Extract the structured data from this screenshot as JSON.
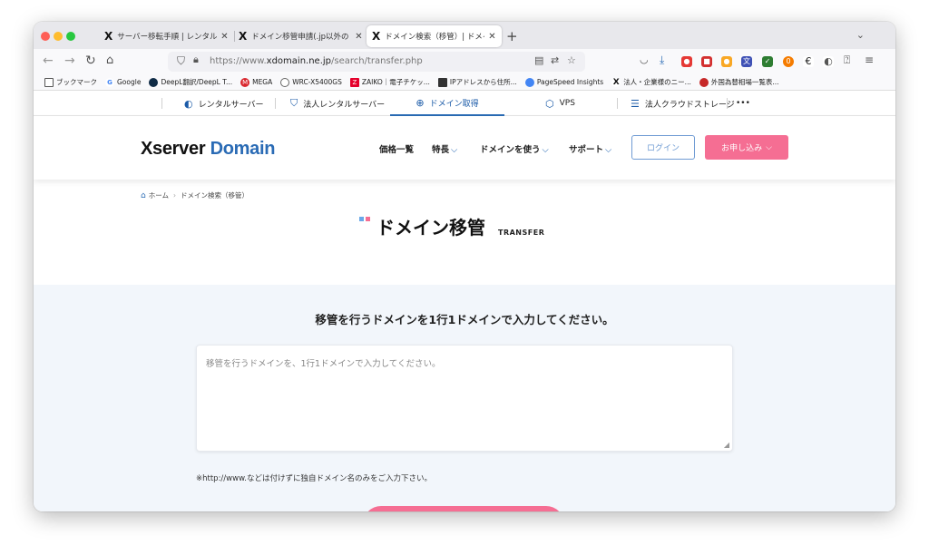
{
  "browser": {
    "tabs": [
      {
        "label": "サーバー移転手順 | レンタルサー",
        "active": false
      },
      {
        "label": "ドメイン移管申請(.jp以外のドメ",
        "active": false
      },
      {
        "label": "ドメイン検索（移管）| ドメイン",
        "active": true
      }
    ],
    "url_prefix": "https://www.",
    "url_host": "xdomain.ne.jp",
    "url_path": "/search/transfer.php"
  },
  "bookmarks": [
    {
      "label": "ブックマーク",
      "icon": "folder-icon",
      "color": "#555555"
    },
    {
      "label": "Google",
      "icon": "google-icon",
      "color": "#4285f4"
    },
    {
      "label": "DeepL翻訳/DeepL T...",
      "icon": "deepl-icon",
      "color": "#0f2b46"
    },
    {
      "label": "MEGA",
      "icon": "mega-icon",
      "color": "#d9272e"
    },
    {
      "label": "WRC-X5400GS",
      "icon": "globe-icon",
      "color": "#666666"
    },
    {
      "label": "ZAIKO｜電子チケッ...",
      "icon": "zaiko-icon",
      "color": "#e4002b"
    },
    {
      "label": "IPアドレスから住所...",
      "icon": "ip-icon",
      "color": "#333333"
    },
    {
      "label": "PageSpeed Insights",
      "icon": "pagespeed-icon",
      "color": "#4285f4"
    },
    {
      "label": "法人・企業様のニー...",
      "icon": "x-icon",
      "color": "#111111"
    },
    {
      "label": "外国為替相場一覧表...",
      "icon": "fx-icon",
      "color": "#c62828"
    }
  ],
  "topnav": [
    {
      "label": "レンタルサーバー",
      "icon": "server-icon",
      "active": false
    },
    {
      "label": "法人レンタルサーバー",
      "icon": "shield-icon",
      "active": false
    },
    {
      "label": "ドメイン取得",
      "icon": "globe-icon",
      "active": true
    },
    {
      "label": "VPS",
      "icon": "cube-icon",
      "active": false
    },
    {
      "label": "法人クラウドストレージ",
      "icon": "storage-icon",
      "active": false
    },
    {
      "label": "•••",
      "icon": "more-icon",
      "active": false
    }
  ],
  "header": {
    "logo_part1": "Xserver",
    "logo_part2": "Domain",
    "menu": [
      {
        "label": "価格一覧",
        "dropdown": false
      },
      {
        "label": "特長",
        "dropdown": true
      },
      {
        "label": "ドメインを使う",
        "dropdown": true
      },
      {
        "label": "サポート",
        "dropdown": true
      }
    ],
    "login_label": "ログイン",
    "apply_label": "お申し込み"
  },
  "breadcrumb": {
    "home": "ホーム",
    "current": "ドメイン検索（移管）"
  },
  "page_title": {
    "main": "ドメイン移管",
    "sub": "TRANSFER"
  },
  "form": {
    "prompt": "移管を行うドメインを1行1ドメインで入力してください。",
    "placeholder": "移管を行うドメインを、1行1ドメインで入力してください。",
    "note": "※http://www.などは付けずに独自ドメイン名のみをご入力下さい。"
  },
  "colors": {
    "accent_blue": "#2a6bb5",
    "accent_pink": "#f56e93",
    "form_bg": "#f2f6fb"
  }
}
